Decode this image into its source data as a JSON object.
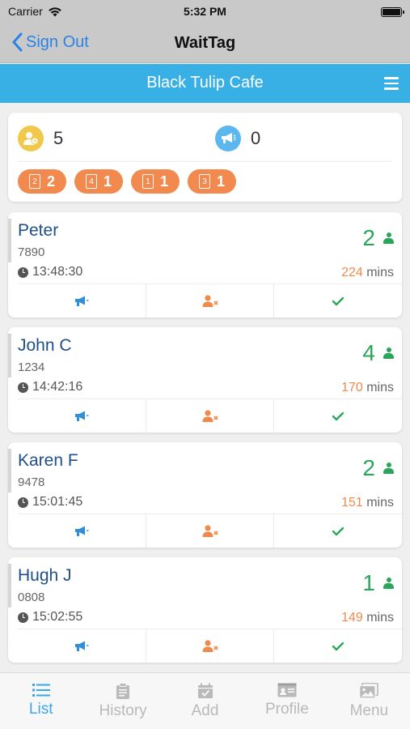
{
  "status_bar": {
    "carrier": "Carrier",
    "time": "5:32 PM"
  },
  "nav": {
    "back_label": "Sign Out",
    "title": "WaitTag"
  },
  "header": {
    "cafe_name": "Black Tulip Cafe"
  },
  "summary": {
    "waiting_count": "5",
    "called_count": "0",
    "table_pills": [
      {
        "table": "2",
        "count": "2"
      },
      {
        "table": "4",
        "count": "1"
      },
      {
        "table": "1",
        "count": "1"
      },
      {
        "table": "3",
        "count": "1"
      }
    ]
  },
  "entries": [
    {
      "name": "Peter",
      "phone": "7890",
      "time": "13:48:30",
      "party_size": "2",
      "wait": "224",
      "unit": "mins"
    },
    {
      "name": "John C",
      "phone": "1234",
      "time": "14:42:16",
      "party_size": "4",
      "wait": "170",
      "unit": "mins"
    },
    {
      "name": "Karen F",
      "phone": "9478",
      "time": "15:01:45",
      "party_size": "2",
      "wait": "151",
      "unit": "mins"
    },
    {
      "name": "Hugh J",
      "phone": "0808",
      "time": "15:02:55",
      "party_size": "1",
      "wait": "149",
      "unit": "mins"
    }
  ],
  "tabs": [
    {
      "label": "List",
      "icon": "list-icon",
      "active": true
    },
    {
      "label": "History",
      "icon": "clipboard-icon",
      "active": false
    },
    {
      "label": "Add",
      "icon": "calendar-check-icon",
      "active": false
    },
    {
      "label": "Profile",
      "icon": "id-card-icon",
      "active": false
    },
    {
      "label": "Menu",
      "icon": "images-icon",
      "active": false
    }
  ],
  "colors": {
    "header_blue": "#38b0e6",
    "orange": "#f2894f",
    "green": "#2aa55a",
    "name_blue": "#1f4f86",
    "tab_active": "#3aa7e6"
  }
}
